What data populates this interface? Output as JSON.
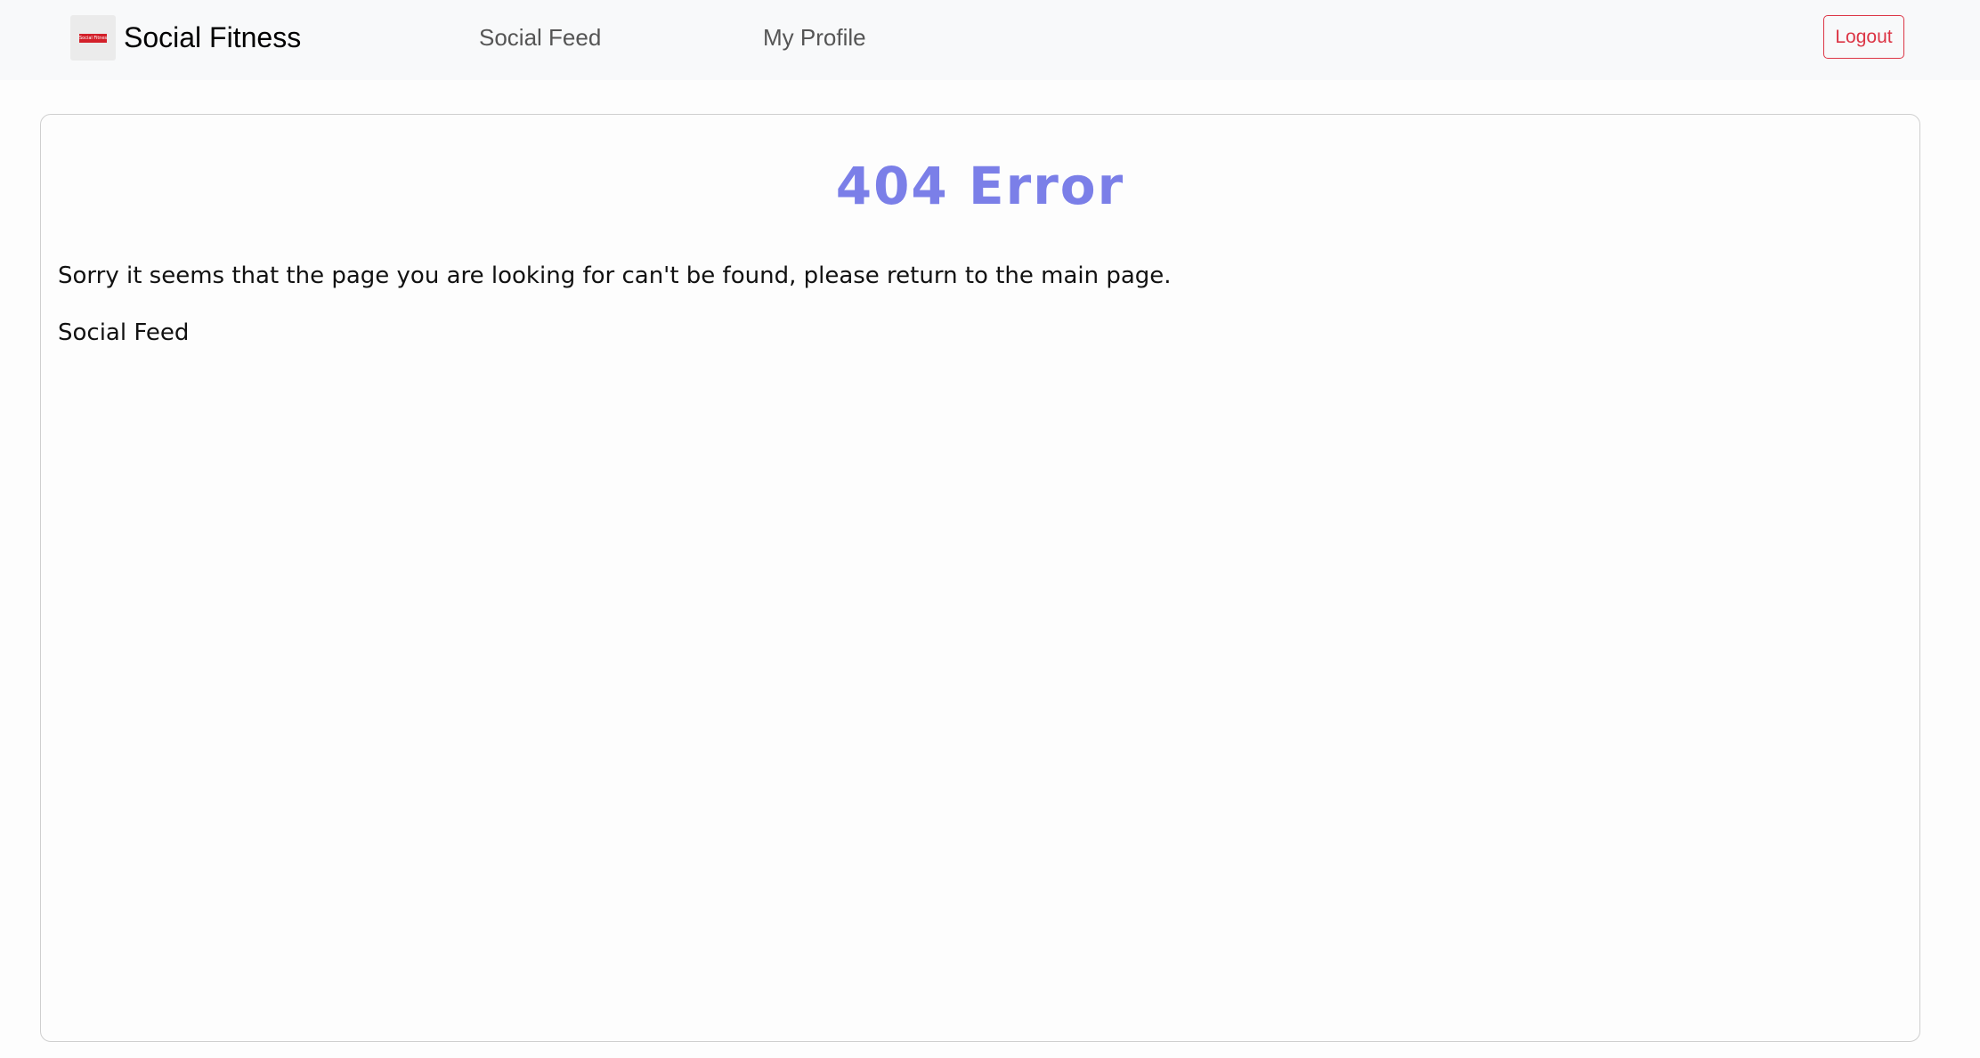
{
  "navbar": {
    "brand": {
      "logo_icon": "social-fitness-logo",
      "logo_text": "Social Fitness",
      "name": "Social Fitness"
    },
    "links": [
      {
        "label": "Social Feed"
      },
      {
        "label": "My Profile"
      }
    ],
    "logout_label": "Logout"
  },
  "error_page": {
    "title": "404 Error",
    "message": "Sorry it seems that the page you are looking for can't be found, please return to the main page.",
    "return_link_label": "Social Feed"
  },
  "colors": {
    "navbar_background": "#f8f9fa",
    "title_accent": "#7b7fe8",
    "logout_red": "#dc3545",
    "card_border": "#cfcfcf"
  }
}
